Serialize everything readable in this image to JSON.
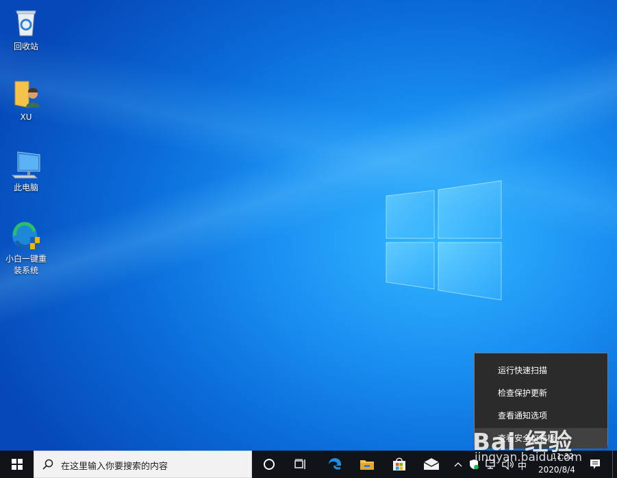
{
  "desktop": {
    "icons": [
      {
        "label": "回收站",
        "icon": "recycle-bin-icon"
      },
      {
        "label": "XU",
        "icon": "user-folder-icon"
      },
      {
        "label": "此电脑",
        "icon": "computer-icon"
      },
      {
        "label": "小白一键重\n装系统",
        "icon": "xiaobai-reinstall-icon"
      }
    ]
  },
  "context_menu": {
    "items": [
      {
        "label": "运行快速扫描"
      },
      {
        "label": "检查保护更新"
      },
      {
        "label": "查看通知选项"
      },
      {
        "label": "查看安全仪表板"
      }
    ]
  },
  "taskbar": {
    "search_placeholder": "在这里输入你要搜索的内容",
    "ime_label": "中",
    "time": "11:32",
    "date": "2020/8/4"
  },
  "watermark": {
    "brand": "Bai 经验",
    "url": "jingyan.baidu.com"
  },
  "colors": {
    "taskbar_bg": "#101418",
    "menu_bg": "#2b2b2b",
    "desktop_accent": "#1a90f2"
  }
}
